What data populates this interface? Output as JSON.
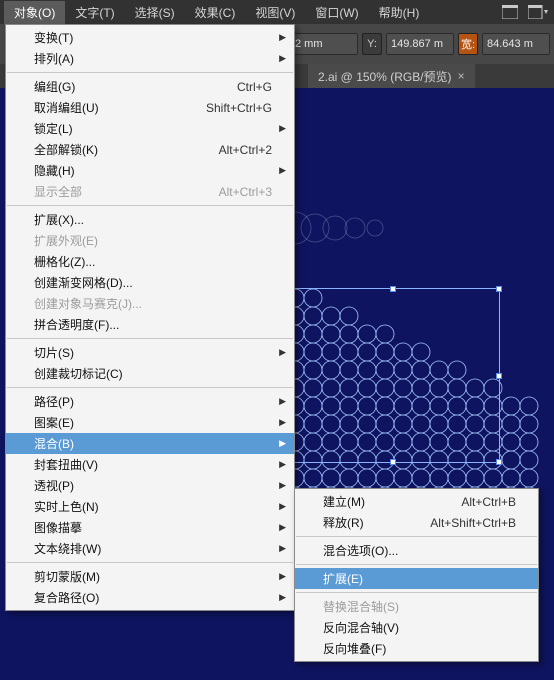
{
  "menubar": {
    "items": [
      "对象(O)",
      "文字(T)",
      "选择(S)",
      "效果(C)",
      "视图(V)",
      "窗口(W)",
      "帮助(H)"
    ],
    "active_index": 0
  },
  "controlbar": {
    "xfield_suffix": "2 mm",
    "y_label": "Y:",
    "y_value": "149.867 m",
    "w_label": "宽:",
    "w_value": "84.643 m"
  },
  "tab": {
    "title": "2.ai @ 150% (RGB/预览)",
    "close": "×"
  },
  "menu": {
    "groups": [
      [
        {
          "label": "变换(T)",
          "sub": true
        },
        {
          "label": "排列(A)",
          "sub": true
        }
      ],
      [
        {
          "label": "编组(G)",
          "shortcut": "Ctrl+G"
        },
        {
          "label": "取消编组(U)",
          "shortcut": "Shift+Ctrl+G"
        },
        {
          "label": "锁定(L)",
          "sub": true
        },
        {
          "label": "全部解锁(K)",
          "shortcut": "Alt+Ctrl+2"
        },
        {
          "label": "隐藏(H)",
          "sub": true
        },
        {
          "label": "显示全部",
          "shortcut": "Alt+Ctrl+3",
          "disabled": true
        }
      ],
      [
        {
          "label": "扩展(X)..."
        },
        {
          "label": "扩展外观(E)",
          "disabled": true
        },
        {
          "label": "栅格化(Z)..."
        },
        {
          "label": "创建渐变网格(D)..."
        },
        {
          "label": "创建对象马赛克(J)...",
          "disabled": true
        },
        {
          "label": "拼合透明度(F)..."
        }
      ],
      [
        {
          "label": "切片(S)",
          "sub": true
        },
        {
          "label": "创建裁切标记(C)"
        }
      ],
      [
        {
          "label": "路径(P)",
          "sub": true
        },
        {
          "label": "图案(E)",
          "sub": true
        },
        {
          "label": "混合(B)",
          "sub": true,
          "hover": true
        },
        {
          "label": "封套扭曲(V)",
          "sub": true
        },
        {
          "label": "透视(P)",
          "sub": true
        },
        {
          "label": "实时上色(N)",
          "sub": true
        },
        {
          "label": "图像描摹",
          "sub": true
        },
        {
          "label": "文本绕排(W)",
          "sub": true
        }
      ],
      [
        {
          "label": "剪切蒙版(M)",
          "sub": true
        },
        {
          "label": "复合路径(O)",
          "sub": true
        }
      ]
    ]
  },
  "submenu": {
    "groups": [
      [
        {
          "label": "建立(M)",
          "shortcut": "Alt+Ctrl+B"
        },
        {
          "label": "释放(R)",
          "shortcut": "Alt+Shift+Ctrl+B"
        }
      ],
      [
        {
          "label": "混合选项(O)..."
        }
      ],
      [
        {
          "label": "扩展(E)",
          "hover": true
        }
      ],
      [
        {
          "label": "替换混合轴(S)",
          "disabled": true
        },
        {
          "label": "反向混合轴(V)"
        },
        {
          "label": "反向堆叠(F)"
        }
      ]
    ]
  }
}
